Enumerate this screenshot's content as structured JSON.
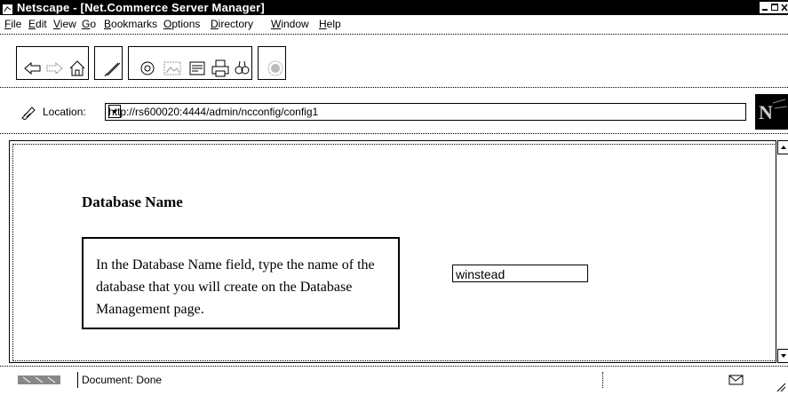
{
  "window": {
    "title": "Netscape - [Net.Commerce Server Manager]"
  },
  "menu": [
    {
      "label": "File"
    },
    {
      "label": "Edit"
    },
    {
      "label": "View"
    },
    {
      "label": "Go"
    },
    {
      "label": "Bookmarks"
    },
    {
      "label": "Options"
    },
    {
      "label": "Directory"
    },
    {
      "label": "Window"
    },
    {
      "label": "Help"
    }
  ],
  "toolbar": {
    "buttons": [
      "back-icon",
      "forward-icon",
      "home-icon",
      "edit-icon",
      "reload-icon",
      "images-icon",
      "open-icon",
      "print-icon",
      "find-icon",
      "stop-icon"
    ]
  },
  "location": {
    "label": "Location:",
    "url": "http://rs600020:4444/admin/ncconfig/config1"
  },
  "content": {
    "heading": "Database Name",
    "info": "In the Database Name field, type the name of the database that you will create on the Database Management page.",
    "db_name_value": "winstead"
  },
  "status": {
    "text": "Document: Done"
  }
}
